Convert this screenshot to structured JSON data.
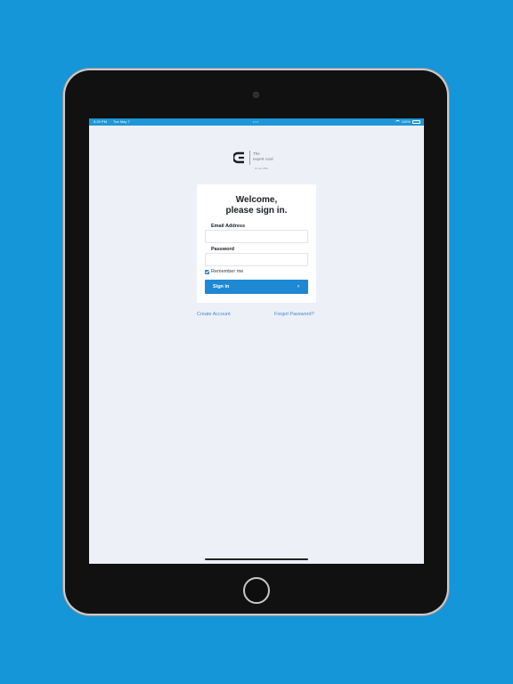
{
  "status_bar": {
    "time": "5:29 PM",
    "date": "Tue May 7",
    "dots": "•••",
    "battery": "100%"
  },
  "logo": {
    "line1": "The",
    "line2": "expert cord",
    "tagline": "for your office"
  },
  "login": {
    "title_line1": "Welcome,",
    "title_line2": "please sign in.",
    "email_label": "Email Address",
    "email_value": "",
    "password_label": "Password",
    "password_value": "",
    "remember_label": "Remember me",
    "remember_checked": true,
    "signin_label": "Sign in"
  },
  "links": {
    "create_account": "Create Account",
    "forgot_password": "Forgot Password?"
  },
  "colors": {
    "background": "#1496d8",
    "screen": "#eef0f8",
    "primary": "#1f88d3",
    "link": "#3e8ad6"
  }
}
